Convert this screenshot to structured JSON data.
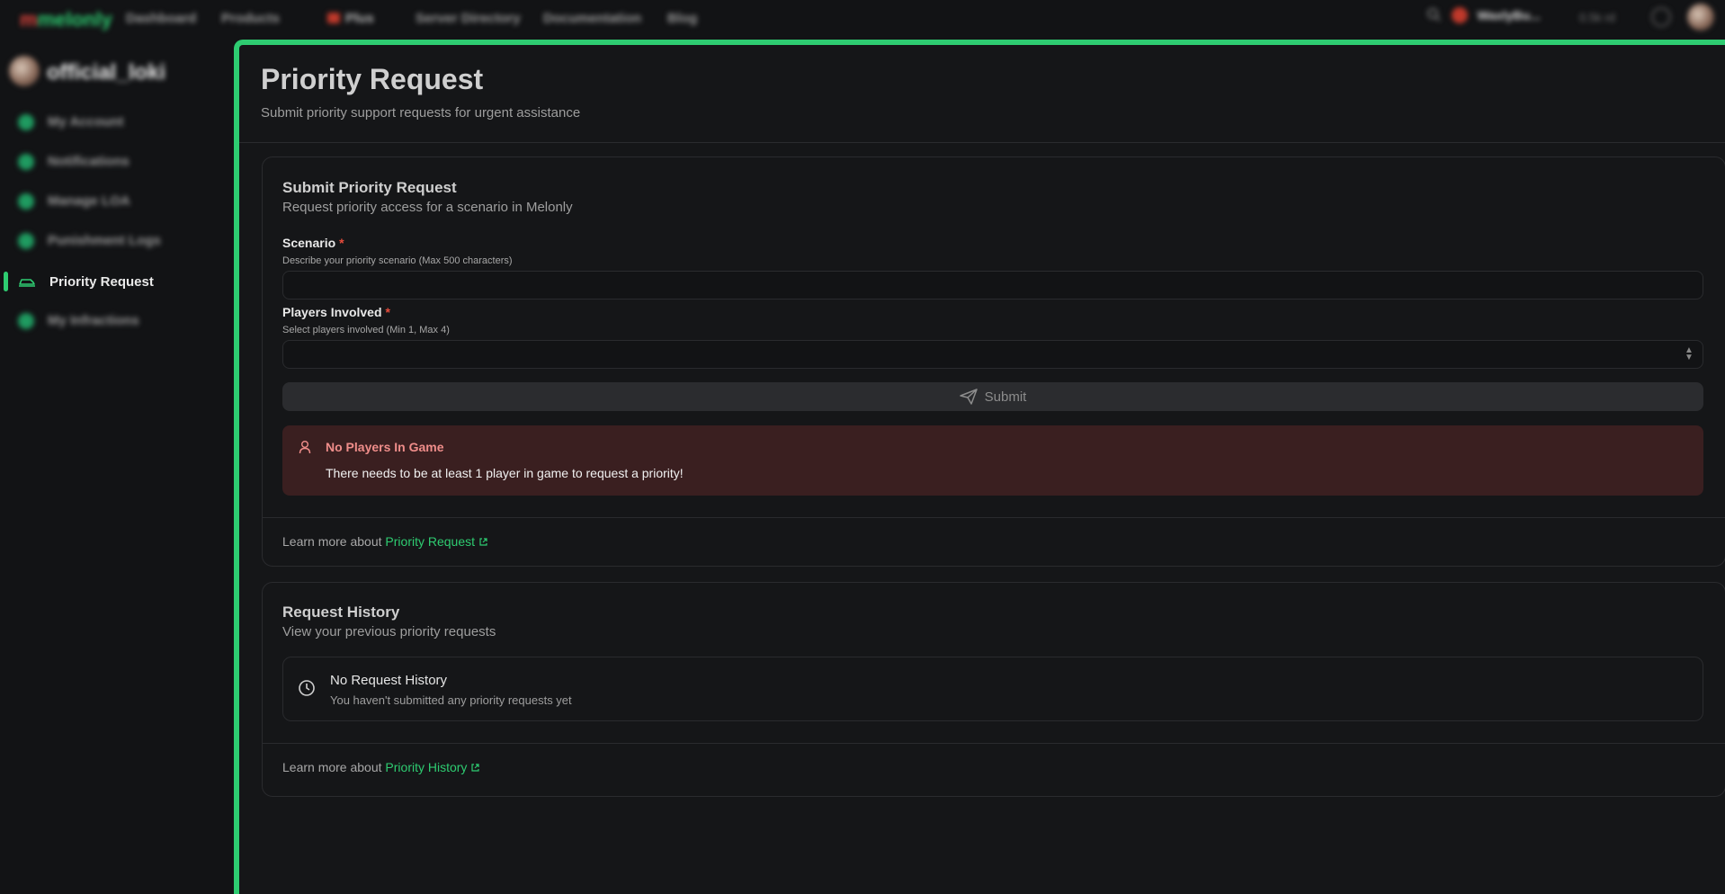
{
  "topnav": {
    "logo": "melonly",
    "links": [
      "Dashboard",
      "Products",
      "Plus",
      "Server Directory",
      "Documentation",
      "Blog"
    ],
    "user_short": "WaxlyBu...",
    "status": "0.5k rd"
  },
  "sidebar": {
    "username": "official_loki",
    "items": [
      {
        "label": "My Account"
      },
      {
        "label": "Notifications"
      },
      {
        "label": "Manage LOA"
      },
      {
        "label": "Punishment Logs"
      },
      {
        "label": "Priority Request"
      },
      {
        "label": "My Infractions"
      }
    ],
    "active_index": 4
  },
  "page": {
    "title": "Priority Request",
    "subtitle": "Submit priority support requests for urgent assistance"
  },
  "submit_card": {
    "title": "Submit Priority Request",
    "subtitle": "Request priority access for a scenario in Melonly",
    "scenario": {
      "label": "Scenario",
      "required_mark": "*",
      "help": "Describe your priority scenario (Max 500 characters)",
      "value": ""
    },
    "players": {
      "label": "Players Involved",
      "required_mark": "*",
      "help": "Select players involved (Min 1, Max 4)",
      "value": ""
    },
    "submit_label": "Submit",
    "alert": {
      "title": "No Players In Game",
      "text": "There needs to be at least 1 player in game to request a priority!"
    },
    "learn_prefix": "Learn more about",
    "learn_link": "Priority Request"
  },
  "history_card": {
    "title": "Request History",
    "subtitle": "View your previous priority requests",
    "empty_title": "No Request History",
    "empty_text": "You haven't submitted any priority requests yet",
    "learn_prefix": "Learn more about",
    "learn_link": "Priority History"
  },
  "colors": {
    "accent": "#2ecc71",
    "background": "#121315",
    "alert_bg": "#3a1f20",
    "alert_title": "#ef8d8a",
    "required": "#e74c3c"
  }
}
